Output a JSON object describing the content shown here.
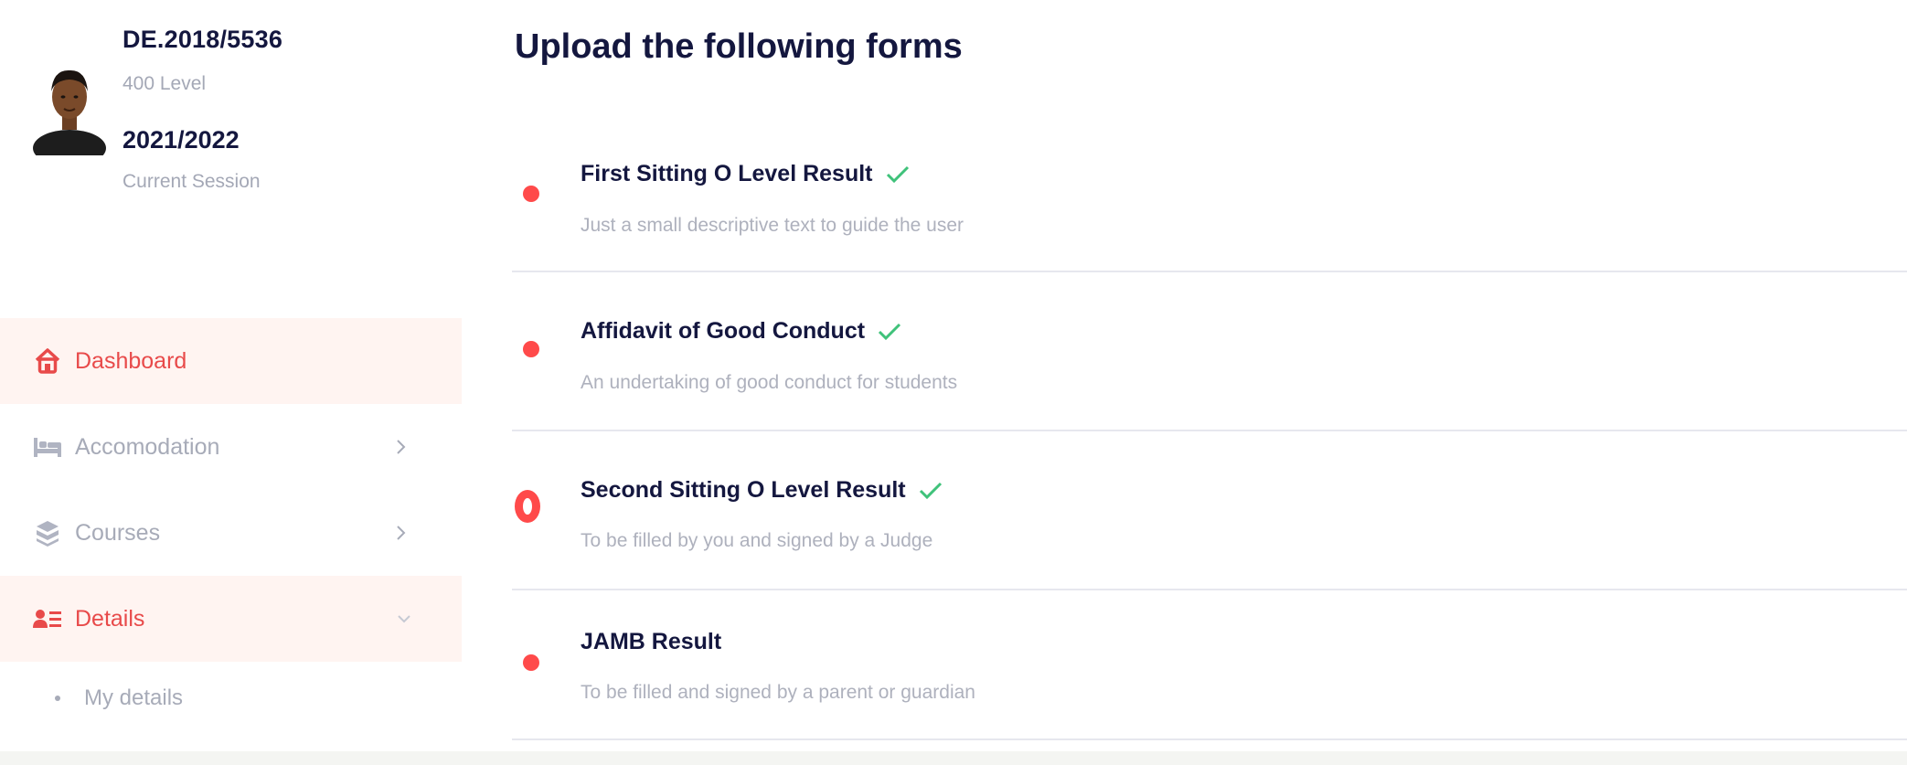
{
  "profile": {
    "student_id": "DE.2018/5536",
    "level": "400 Level",
    "session": "2021/2022",
    "session_label": "Current Session"
  },
  "nav": {
    "dashboard": "Dashboard",
    "accomodation": "Accomodation",
    "courses": "Courses",
    "details": "Details",
    "my_details": "My details"
  },
  "main": {
    "title": "Upload the following forms",
    "forms": [
      {
        "title": "First Sitting O Level Result",
        "desc": "Just a small descriptive text to guide the user",
        "checked": true
      },
      {
        "title": "Affidavit of Good Conduct",
        "desc": "An undertaking of good conduct for students",
        "checked": true
      },
      {
        "title": "Second Sitting O Level Result",
        "desc": "To be filled by you and signed by a Judge",
        "checked": true
      },
      {
        "title": "JAMB Result",
        "desc": "To be filled and signed by a parent or guardian",
        "checked": false
      }
    ]
  },
  "colors": {
    "accent": "#ff4a4a",
    "navy": "#14173f",
    "muted": "#a7abb8",
    "check": "#3fc27a",
    "active_bg": "#fff4f1"
  },
  "icons": {
    "dashboard": "house-icon",
    "accomodation": "bed-icon",
    "courses": "book-stack-icon",
    "details": "id-card-icon"
  }
}
